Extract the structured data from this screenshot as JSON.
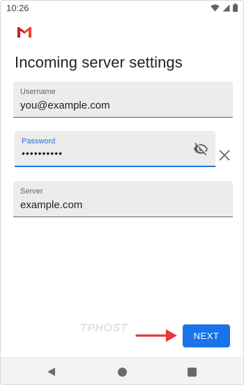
{
  "status_bar": {
    "time": "10:26"
  },
  "header": {
    "title": "Incoming server settings"
  },
  "form": {
    "username": {
      "label": "Username",
      "value": "you@example.com"
    },
    "password": {
      "label": "Password",
      "value": "••••••••••"
    },
    "server": {
      "label": "Server",
      "value": "example.com"
    }
  },
  "watermark": "TPHOST",
  "actions": {
    "next_label": "NEXT"
  },
  "colors": {
    "accent": "#1a73e8",
    "arrow": "#e53935",
    "field_bg": "#ececec"
  },
  "icons": {
    "logo": "gmail-icon",
    "visibility": "visibility-off-icon",
    "clear": "close-icon",
    "nav_back": "back-triangle-icon",
    "nav_home": "home-circle-icon",
    "nav_recent": "recent-square-icon"
  }
}
